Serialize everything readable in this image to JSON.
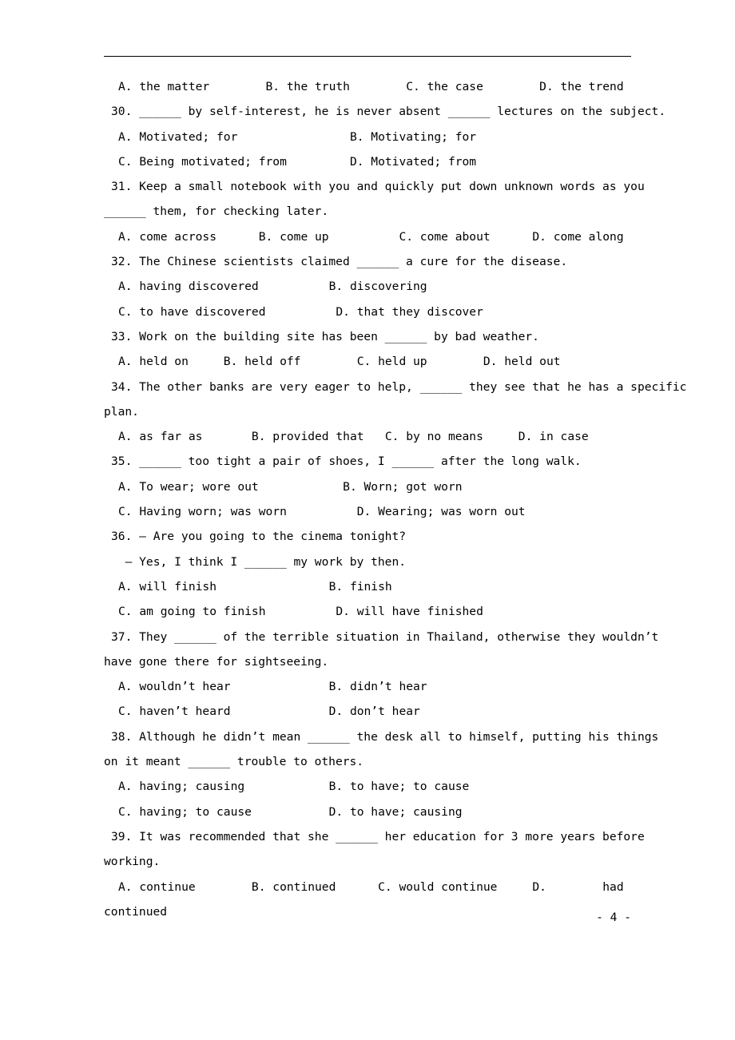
{
  "document": {
    "page_number_label": "- 4 -",
    "lines": [
      {
        "indent": 1,
        "text": "A. the matter        B. the truth        C. the case        D. the trend"
      },
      {
        "indent": 2,
        "text": "30. ______ by self-interest, he is never absent ______ lectures on the subject."
      },
      {
        "indent": 1,
        "text": "A. Motivated; for                B. Motivating; for"
      },
      {
        "indent": 1,
        "text": "C. Being motivated; from         D. Motivated; from"
      },
      {
        "indent": 2,
        "text": "31. Keep a small notebook with you and quickly put down unknown words as you"
      },
      {
        "indent": 0,
        "text": "______ them, for checking later."
      },
      {
        "indent": 1,
        "text": "A. come across      B. come up          C. come about      D. come along"
      },
      {
        "indent": 2,
        "text": "32. The Chinese scientists claimed ______ a cure for the disease."
      },
      {
        "indent": 1,
        "text": "A. having discovered          B. discovering"
      },
      {
        "indent": 1,
        "text": "C. to have discovered          D. that they discover"
      },
      {
        "indent": 2,
        "text": "33. Work on the building site has been ______ by bad weather."
      },
      {
        "indent": 1,
        "text": "A. held on     B. held off        C. held up        D. held out"
      },
      {
        "indent": 2,
        "text": "34. The other banks are very eager to help, ______ they see that he has a specific"
      },
      {
        "indent": 0,
        "text": "plan."
      },
      {
        "indent": 1,
        "text": "A. as far as       B. provided that   C. by no means     D. in case"
      },
      {
        "indent": 2,
        "text": "35. ______ too tight a pair of shoes, I ______ after the long walk."
      },
      {
        "indent": 1,
        "text": "A. To wear; wore out            B. Worn; got worn"
      },
      {
        "indent": 1,
        "text": "C. Having worn; was worn          D. Wearing; was worn out"
      },
      {
        "indent": 2,
        "text": "36. — Are you going to the cinema tonight?"
      },
      {
        "indent": 2,
        "text": "  — Yes, I think I ______ my work by then."
      },
      {
        "indent": 1,
        "text": "A. will finish                B. finish"
      },
      {
        "indent": 1,
        "text": "C. am going to finish          D. will have finished"
      },
      {
        "indent": 2,
        "text": "37. They ______ of the terrible situation in Thailand, otherwise they wouldn’t"
      },
      {
        "indent": 0,
        "text": "have gone there for sightseeing."
      },
      {
        "indent": 1,
        "text": "A. wouldn’t hear              B. didn’t hear"
      },
      {
        "indent": 1,
        "text": "C. haven’t heard              D. don’t hear"
      },
      {
        "indent": 2,
        "text": "38. Although he didn’t mean ______ the desk all to himself, putting his things"
      },
      {
        "indent": 0,
        "text": "on it meant ______ trouble to others."
      },
      {
        "indent": 1,
        "text": "A. having; causing            B. to have; to cause"
      },
      {
        "indent": 1,
        "text": "C. having; to cause           D. to have; causing"
      },
      {
        "indent": 2,
        "text": "39. It was recommended that she ______ her education for 3 more years before"
      },
      {
        "indent": 0,
        "text": "working."
      },
      {
        "indent": 1,
        "text": "A. continue        B. continued      C. would continue     D.        had"
      },
      {
        "indent": 0,
        "text": "continued"
      }
    ]
  }
}
